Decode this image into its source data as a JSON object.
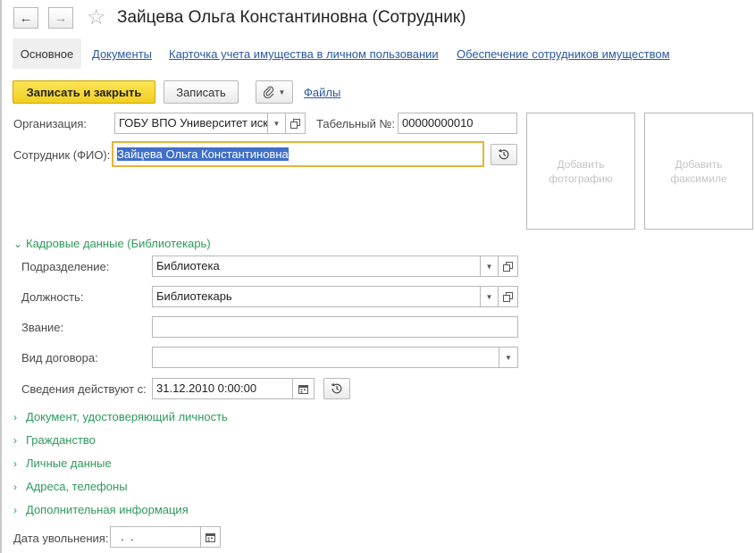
{
  "window": {
    "title": "Зайцева Ольга Константиновна (Сотрудник)"
  },
  "tabs": [
    {
      "label": "Основное",
      "active": true
    },
    {
      "label": "Документы"
    },
    {
      "label": "Карточка учета имущества в личном пользовании"
    },
    {
      "label": "Обеспечение сотрудников имуществом"
    }
  ],
  "toolbar": {
    "save_close_label": "Записать и закрыть",
    "save_label": "Записать",
    "files_label": "Файлы"
  },
  "form": {
    "organization_label": "Организация:",
    "organization_value": "ГОБУ ВПО Университет иск",
    "tabnum_label": "Табельный №:",
    "tabnum_value": "00000000010",
    "employee_label": "Сотрудник (ФИО):",
    "employee_value": "Зайцева Ольга Константиновна",
    "add_photo_line1": "Добавить",
    "add_photo_line2": "фотографию",
    "add_facsimile_line1": "Добавить",
    "add_facsimile_line2": "факсимиле"
  },
  "hr": {
    "group_label": "Кадровые данные (Библиотекарь)",
    "department_label": "Подразделение:",
    "department_value": "Библиотека",
    "position_label": "Должность:",
    "position_value": "Библиотекарь",
    "rank_label": "Звание:",
    "rank_value": "",
    "contract_label": "Вид договора:",
    "contract_value": "",
    "effective_label": "Сведения действуют с:",
    "effective_value": "31.12.2010  0:00:00"
  },
  "sections": [
    "Документ, удостоверяющий личность",
    "Гражданство",
    "Личные данные",
    "Адреса, телефоны",
    "Дополнительная информация"
  ],
  "dismissal": {
    "label": "Дата увольнения:",
    "value": "  .  ."
  },
  "colors": {
    "accent_yellow": "#f1cf22",
    "link_blue": "#2a58a0",
    "group_green": "#2e9a5c",
    "focus_border": "#e8b23a",
    "selection": "#3f6fc9"
  }
}
